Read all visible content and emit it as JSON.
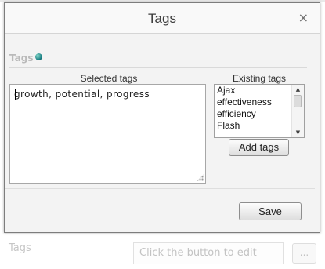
{
  "background": {
    "tags_label": "Tags",
    "input_placeholder": "Click the button to edit",
    "ellipsis_button": "..."
  },
  "dialog": {
    "title": "Tags",
    "close_glyph": "×",
    "section_legend": "Tags",
    "selected_caption": "Selected tags",
    "selected_value": "growth, potential, progress",
    "existing_caption": "Existing tags",
    "existing_items": [
      "Ajax",
      "effectiveness",
      "efficiency",
      "Flash"
    ],
    "add_button": "Add tags",
    "save_button": "Save"
  },
  "colors": {
    "dialog_bg": "#f3f3f3",
    "titlebar_bg": "#f9f9f9",
    "legend_text": "#bababa"
  },
  "icons": {
    "globe": "globe-icon",
    "close": "close-icon",
    "scroll_up": "arrow-up-icon",
    "scroll_down": "arrow-down-icon",
    "resize": "resize-grip-icon"
  }
}
